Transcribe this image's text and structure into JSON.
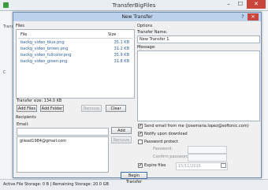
{
  "outer": {
    "title": "TransferBigFiles",
    "minimize": "–",
    "maximize": "☐",
    "close": "✕",
    "status": "Active File Storage: 0 B | Remaining Storage: 20.0 GB"
  },
  "dialog": {
    "title": "New Transfer",
    "help": "?",
    "close": "✕",
    "files": {
      "section": "Files",
      "col_file": "File",
      "col_size": "Size",
      "rows": [
        {
          "name": "backg_video_blue.png",
          "size": "35.1 KB"
        },
        {
          "name": "backg_video_brown.png",
          "size": "31.2 KB"
        },
        {
          "name": "backg_video_fullcolor.png",
          "size": "35.9 KB"
        },
        {
          "name": "backg_video_green.png",
          "size": "31.8 KB"
        }
      ],
      "transfer_size": "Transfer size: 134.0 KB",
      "add_files": "Add Files",
      "add_folder": "Add Folder",
      "remove": "Remove",
      "clear": "Clear"
    },
    "recipients": {
      "section": "Recipients",
      "email_label": "Email:",
      "email_value": "",
      "add": "Add",
      "remove": "Remove",
      "list": [
        "gilead1984@gmail.com"
      ]
    },
    "options": {
      "section": "Options",
      "transfer_name_label": "Transfer Name:",
      "transfer_name_value": "New Transfer 1",
      "message_label": "Message:",
      "message_value": "",
      "send_email": {
        "label": "Send email from me (josemaria.lopez@softonic.com)",
        "checked": "✔"
      },
      "notify": {
        "label": "Notify upon download",
        "checked": "✔"
      },
      "password_protect": {
        "label": "Password protect",
        "checked": ""
      },
      "password_label": "Password:",
      "confirm_label": "Confirm password:",
      "expire": {
        "label": "Expire files",
        "checked": "✔",
        "date": "15/11/2015"
      }
    },
    "begin": "Begin Transfer"
  },
  "left_fragment": {
    "top": "Trans",
    "side": "C"
  }
}
